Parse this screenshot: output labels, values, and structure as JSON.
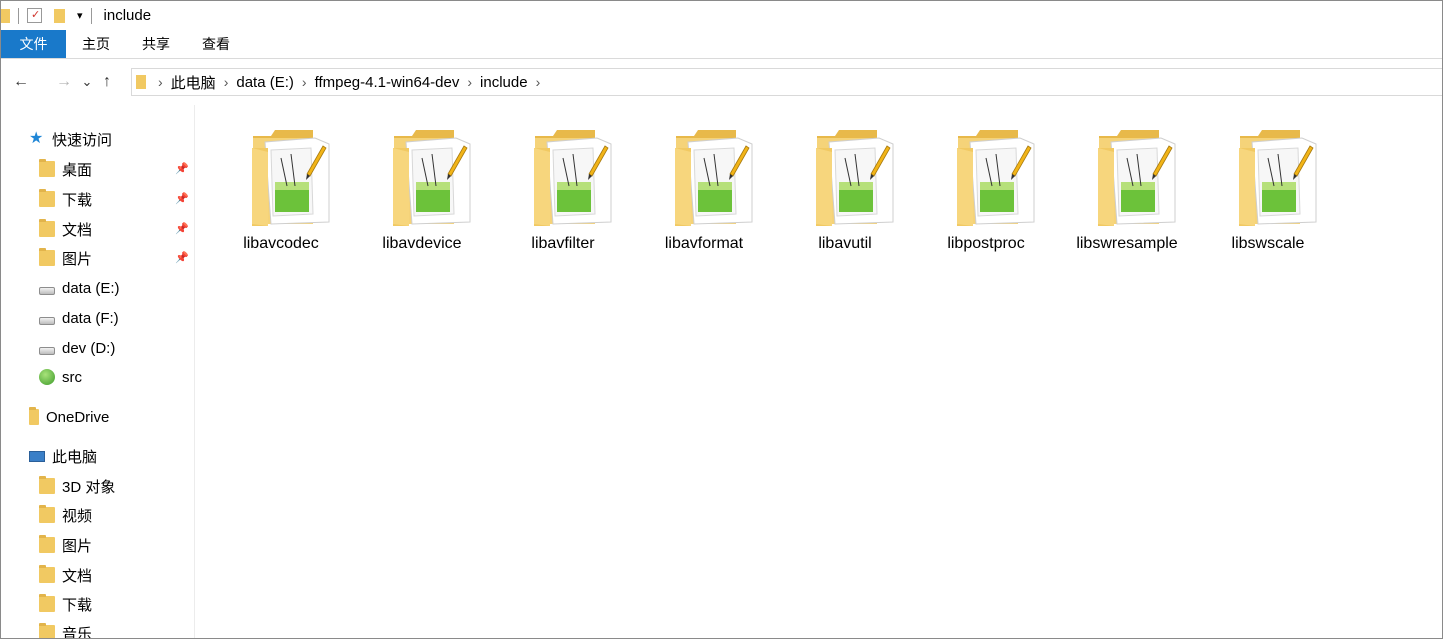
{
  "window": {
    "title": "include",
    "quick_access_dropdown": "▾"
  },
  "ribbon": {
    "tabs": [
      "文件",
      "主页",
      "共享",
      "查看"
    ]
  },
  "nav": {
    "back": "←",
    "forward": "→",
    "recent": "⌄",
    "up": "↑"
  },
  "breadcrumb": [
    "此电脑",
    "data (E:)",
    "ffmpeg-4.1-win64-dev",
    "include"
  ],
  "sidebar": {
    "quick_access": "快速访问",
    "pinned": [
      {
        "label": "桌面",
        "pinned": true
      },
      {
        "label": "下载",
        "pinned": true
      },
      {
        "label": "文档",
        "pinned": true
      },
      {
        "label": "图片",
        "pinned": true
      }
    ],
    "drives": [
      {
        "label": "data (E:)"
      },
      {
        "label": "data (F:)"
      },
      {
        "label": "dev (D:)"
      },
      {
        "label": "src"
      }
    ],
    "onedrive": "OneDrive",
    "this_pc": "此电脑",
    "pc_items": [
      {
        "label": "3D 对象"
      },
      {
        "label": "视频"
      },
      {
        "label": "图片"
      },
      {
        "label": "文档"
      },
      {
        "label": "下载"
      },
      {
        "label": "音乐"
      }
    ]
  },
  "folders": [
    {
      "name": "libavcodec"
    },
    {
      "name": "libavdevice"
    },
    {
      "name": "libavfilter"
    },
    {
      "name": "libavformat"
    },
    {
      "name": "libavutil"
    },
    {
      "name": "libpostproc"
    },
    {
      "name": "libswresample"
    },
    {
      "name": "libswscale"
    }
  ],
  "colors": {
    "file_tab": "#1979ca",
    "folder": "#f1c962",
    "star": "#1f86d6"
  }
}
